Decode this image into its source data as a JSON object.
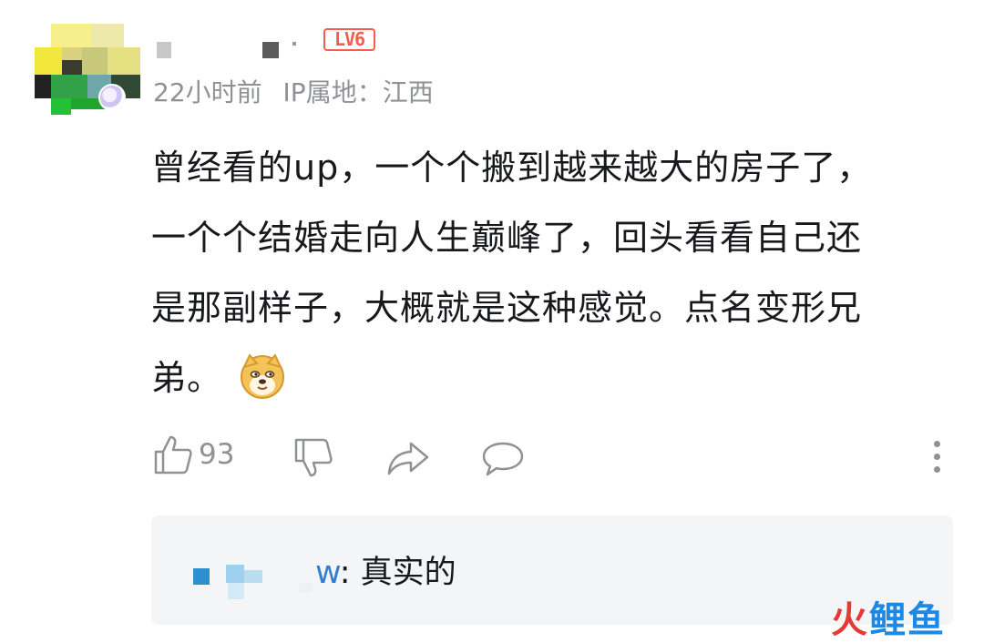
{
  "comment": {
    "level_badge": "LV6",
    "time": "22小时前",
    "ip_location": "IP属地：江西",
    "lines": [
      "曾经看的up，一个个搬到越来越大的房子了，",
      "一个个结婚走向人生巅峰了，回头看看自己还",
      "是那副样子，大概就是这种感觉。点名变形兄",
      "弟。"
    ],
    "emoji_icon": "doge-emoji-icon"
  },
  "actions": {
    "like_count": "93",
    "like_icon": "thumbs-up-icon",
    "dislike_icon": "thumbs-down-icon",
    "share_icon": "share-icon",
    "reply_icon": "comment-bubble-icon",
    "more_icon": "more-vertical-icon"
  },
  "reply": {
    "name_suffix": "w",
    "text": ": 真实的"
  },
  "watermark": {
    "first_char": "火",
    "rest": "鲤鱼"
  },
  "colors": {
    "level_badge": "#f25d4e",
    "meta_gray": "#8f9196",
    "reply_bg": "#f4f5f7",
    "reply_name": "#2f7fd4"
  }
}
